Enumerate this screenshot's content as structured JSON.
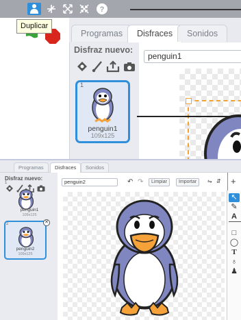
{
  "top": {
    "toolbar": {
      "icons": [
        "duplicate-icon",
        "cut-icon",
        "grow-icon",
        "shrink-icon",
        "help-icon"
      ],
      "tooltip": "Duplicar"
    },
    "tabs": [
      "Programas",
      "Disfraces",
      "Sonidos"
    ],
    "active_tab": "Disfraces",
    "new_costume_label": "Disfraz nuevo:",
    "costume": {
      "number": "1",
      "name": "penguin1",
      "size": "109x125"
    },
    "name_field": "penguin1"
  },
  "bottom": {
    "tabs": [
      "Programas",
      "Disfraces",
      "Sonidos"
    ],
    "active_tab": "Disfraces",
    "new_costume_label": "Disfraz nuevo:",
    "costumes": [
      {
        "number": "1",
        "name": "penguin1",
        "size": "109x125"
      },
      {
        "number": "2",
        "name": "penguin2",
        "size": "109x125"
      }
    ],
    "name_field": "penguin2",
    "buttons": {
      "clear": "Limpiar",
      "import": "Importar"
    }
  },
  "colors": {
    "accent": "#2f8fda",
    "selection": "#f4a22f",
    "penguin_body": "#7f86c0",
    "penguin_beak": "#f5a23a"
  }
}
